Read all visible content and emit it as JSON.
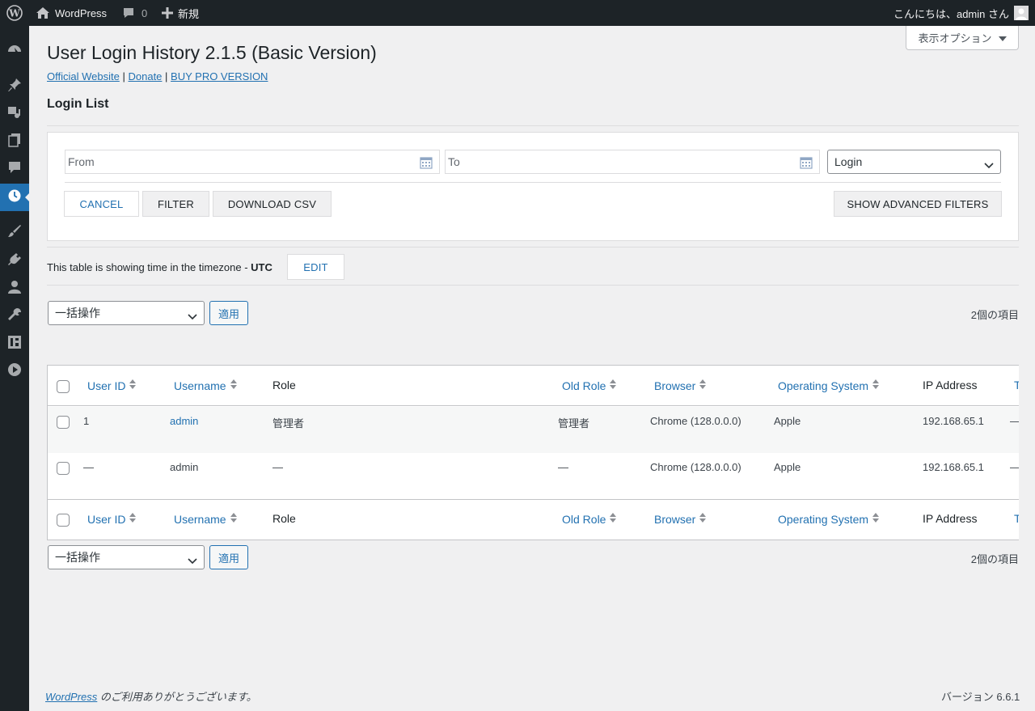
{
  "adminbar": {
    "site_name": "WordPress",
    "comments_count": "0",
    "new_label": "新規",
    "greeting": "こんにちは、admin さん"
  },
  "screen_options": {
    "label": "表示オプション"
  },
  "page": {
    "title": "User Login History 2.1.5 (Basic Version)",
    "links": [
      "Official Website",
      "Donate",
      "BUY PRO VERSION"
    ],
    "link_separator": "|",
    "section_title": "Login List"
  },
  "filters": {
    "from_placeholder": "From",
    "to_placeholder": "To",
    "type_selected": "Login",
    "buttons": {
      "cancel": "CANCEL",
      "filter": "FILTER",
      "download_csv": "DOWNLOAD CSV",
      "advanced": "SHOW ADVANCED FILTERS"
    }
  },
  "timezone": {
    "prefix": "This table is showing time in the timezone - ",
    "zone": "UTC",
    "edit": "EDIT"
  },
  "bulk": {
    "action_label": "一括操作",
    "apply_label": "適用",
    "items_count": "2個の項目"
  },
  "table": {
    "columns": [
      "User ID",
      "Username",
      "Role",
      "Old Role",
      "Browser",
      "Operating System",
      "IP Address",
      "T"
    ],
    "rows": [
      {
        "user_id": "1",
        "username": "admin",
        "role": "管理者",
        "old_role": "管理者",
        "browser": "Chrome (128.0.0.0)",
        "os": "Apple",
        "ip": "192.168.65.1",
        "t": "—"
      },
      {
        "user_id": "—",
        "username": "admin",
        "role": "—",
        "old_role": "—",
        "browser": "Chrome (128.0.0.0)",
        "os": "Apple",
        "ip": "192.168.65.1",
        "t": "—"
      }
    ]
  },
  "footer": {
    "wp_link": "WordPress",
    "thanks": " のご利用ありがとうございます。",
    "version": "バージョン 6.6.1"
  },
  "colors": {
    "admin_bar": "#1d2327",
    "accent": "#2271b1",
    "background": "#f0f0f1"
  }
}
